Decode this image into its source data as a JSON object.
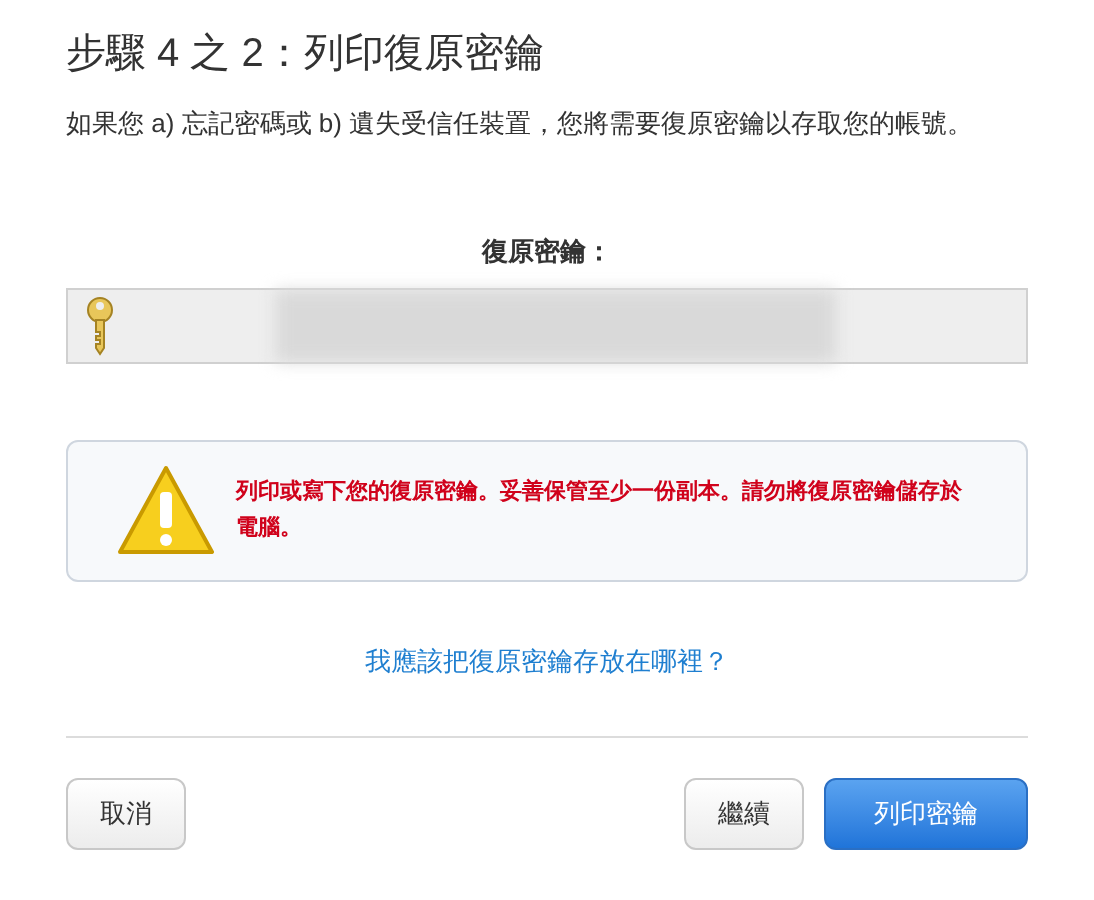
{
  "title": "步驟 4 之 2：列印復原密鑰",
  "description": "如果您 a) 忘記密碼或 b) 遺失受信任裝置，您將需要復原密鑰以存取您的帳號。",
  "key_field": {
    "label": "復原密鑰："
  },
  "warning": {
    "text": "列印或寫下您的復原密鑰。妥善保管至少一份副本。請勿將復原密鑰儲存於電腦。"
  },
  "help_link": "我應該把復原密鑰存放在哪裡？",
  "buttons": [
    {
      "label": "取消",
      "kind": "secondary"
    },
    {
      "label": "繼續",
      "kind": "secondary"
    },
    {
      "label": "列印密鑰",
      "kind": "primary"
    }
  ]
}
